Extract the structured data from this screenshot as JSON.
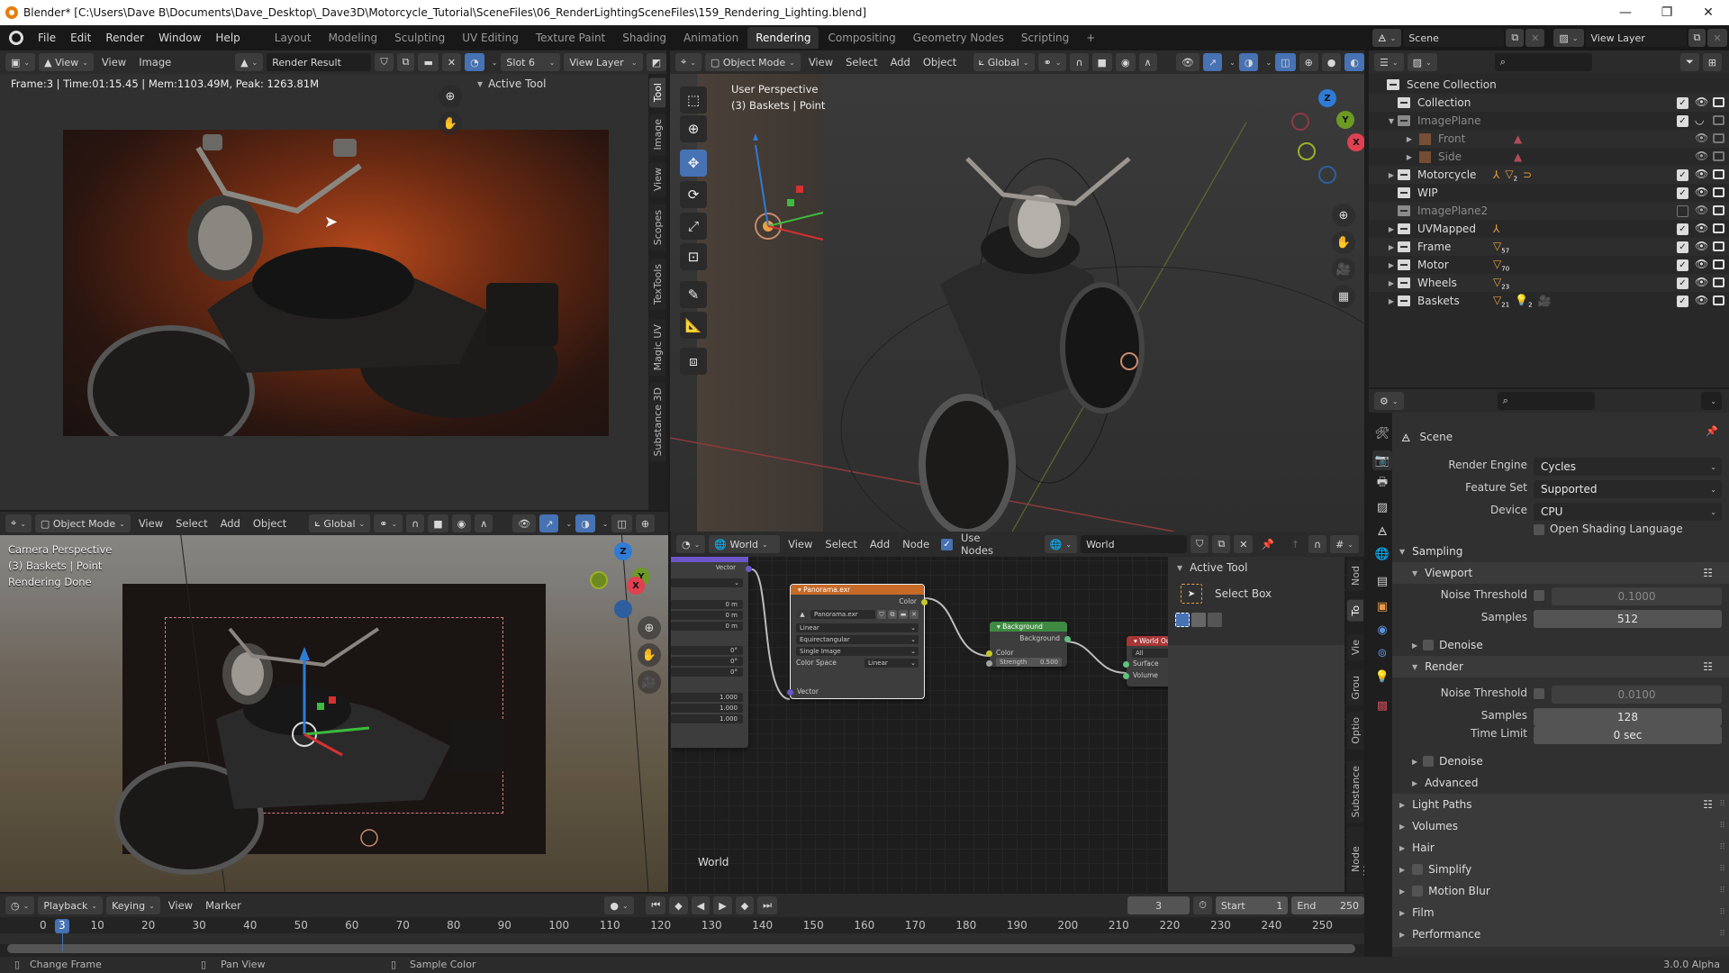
{
  "window": {
    "title": "Blender* [C:\\Users\\Dave B\\Documents\\Dave_Desktop\\_Dave3D\\Motorcycle_Tutorial\\SceneFiles\\06_RenderLightingSceneFiles\\159_Rendering_Lighting.blend]",
    "controls": {
      "minimize": "—",
      "restore": "❐",
      "close": "✕"
    }
  },
  "menubar": {
    "menus": [
      "File",
      "Edit",
      "Render",
      "Window",
      "Help"
    ],
    "workspaces": [
      "Layout",
      "Modeling",
      "Sculpting",
      "UV Editing",
      "Texture Paint",
      "Shading",
      "Animation",
      "Rendering",
      "Compositing",
      "Geometry Nodes",
      "Scripting"
    ],
    "active_workspace": "Rendering",
    "add_tab": "+",
    "scene": "Scene",
    "view_layer": "View Layer"
  },
  "image_editor": {
    "view_mode": "View",
    "menus": [
      "View",
      "Image"
    ],
    "image_name": "Render Result",
    "slot": "Slot 6",
    "layer": "View Layer",
    "render_info": "Frame:3 | Time:01:15.45 | Mem:1103.49M, Peak: 1263.81M",
    "active_tool_panel": "Active Tool",
    "side_tabs": [
      "Tool",
      "Image",
      "View",
      "Scopes",
      "TexTools",
      "Magic UV",
      "Substance 3D"
    ],
    "active_side_tab": "Tool"
  },
  "viewport_top": {
    "mode": "Object Mode",
    "menus": [
      "View",
      "Select",
      "Add",
      "Object"
    ],
    "transform_orientation": "Global",
    "overlay_line1": "User Perspective",
    "overlay_line2": "(3) Baskets | Point",
    "tools": [
      "select-box",
      "cursor",
      "move",
      "rotate",
      "scale",
      "transform",
      "annotate",
      "measure",
      "add-cube"
    ],
    "active_tool": "move",
    "gizmo_axes": {
      "x": "X",
      "y": "Y",
      "z": "Z"
    }
  },
  "viewport_bottom": {
    "mode": "Object Mode",
    "menus": [
      "View",
      "Select",
      "Add",
      "Object"
    ],
    "transform_orientation": "Global",
    "overlay_line1": "Camera Perspective",
    "overlay_line2": "(3) Baskets | Point",
    "overlay_line3": "Rendering Done",
    "gizmo_axes": {
      "x": "X",
      "y": "Y",
      "z": "Z"
    }
  },
  "outliner": {
    "root": "Scene Collection",
    "items": [
      {
        "name": "Collection",
        "indent": 1,
        "expand": false,
        "checked": true,
        "visible": true,
        "render": true,
        "dim": false,
        "badges": []
      },
      {
        "name": "ImagePlane",
        "indent": 1,
        "expand": true,
        "expanded": true,
        "checked": true,
        "visible": false,
        "render": false,
        "dim": true,
        "badges": []
      },
      {
        "name": "Front",
        "indent": 2,
        "expand": true,
        "checked": null,
        "visible": true,
        "render": false,
        "dim": true,
        "badges": [
          "image"
        ]
      },
      {
        "name": "Side",
        "indent": 2,
        "expand": true,
        "checked": null,
        "visible": true,
        "render": false,
        "dim": true,
        "badges": [
          "image"
        ]
      },
      {
        "name": "Motorcycle",
        "indent": 1,
        "expand": true,
        "checked": true,
        "visible": true,
        "render": true,
        "dim": false,
        "badges": [
          "armature",
          "mesh 2",
          "curve"
        ]
      },
      {
        "name": "WIP",
        "indent": 1,
        "expand": false,
        "checked": true,
        "visible": true,
        "render": true,
        "dim": false,
        "badges": []
      },
      {
        "name": "ImagePlane2",
        "indent": 1,
        "expand": false,
        "checked": false,
        "visible": true,
        "render": true,
        "dim": true,
        "badges": []
      },
      {
        "name": "UVMapped",
        "indent": 1,
        "expand": true,
        "checked": true,
        "visible": true,
        "render": true,
        "dim": false,
        "badges": [
          "armature"
        ]
      },
      {
        "name": "Frame",
        "indent": 1,
        "expand": true,
        "checked": true,
        "visible": true,
        "render": true,
        "dim": false,
        "badges": [
          "mesh 57"
        ]
      },
      {
        "name": "Motor",
        "indent": 1,
        "expand": true,
        "checked": true,
        "visible": true,
        "render": true,
        "dim": false,
        "badges": [
          "mesh 70"
        ]
      },
      {
        "name": "Wheels",
        "indent": 1,
        "expand": true,
        "checked": true,
        "visible": true,
        "render": true,
        "dim": false,
        "badges": [
          "mesh 23"
        ]
      },
      {
        "name": "Baskets",
        "indent": 1,
        "expand": true,
        "checked": true,
        "visible": true,
        "render": true,
        "dim": false,
        "badges": [
          "mesh 21",
          "light 2",
          "camera"
        ]
      }
    ]
  },
  "properties": {
    "context": "Scene",
    "render_engine_label": "Render Engine",
    "render_engine": "Cycles",
    "feature_set_label": "Feature Set",
    "feature_set": "Supported",
    "device_label": "Device",
    "device": "CPU",
    "osl_label": "Open Shading Language",
    "osl_checked": false,
    "sampling": {
      "title": "Sampling",
      "viewport": {
        "title": "Viewport",
        "noise_threshold_label": "Noise Threshold",
        "noise_threshold_enabled": false,
        "noise_threshold": "0.1000",
        "samples_label": "Samples",
        "samples": "512",
        "denoise_label": "Denoise"
      },
      "render": {
        "title": "Render",
        "noise_threshold_label": "Noise Threshold",
        "noise_threshold_enabled": false,
        "noise_threshold": "0.0100",
        "samples_label": "Samples",
        "samples": "128",
        "time_limit_label": "Time Limit",
        "time_limit": "0 sec",
        "denoise_label": "Denoise"
      },
      "advanced_label": "Advanced"
    },
    "panels": [
      {
        "label": "Light Paths",
        "checkbox": false
      },
      {
        "label": "Volumes",
        "checkbox": false
      },
      {
        "label": "Hair",
        "checkbox": false
      },
      {
        "label": "Simplify",
        "checkbox": true
      },
      {
        "label": "Motion Blur",
        "checkbox": true
      },
      {
        "label": "Film",
        "checkbox": false
      },
      {
        "label": "Performance",
        "checkbox": false
      }
    ],
    "tabs": [
      "tool",
      "render",
      "output",
      "view-layer",
      "scene",
      "world",
      "collection",
      "object",
      "physics",
      "constraints",
      "data-light",
      "texture"
    ],
    "active_tab": "render"
  },
  "node_editor": {
    "type": "World",
    "menus": [
      "View",
      "Select",
      "Add",
      "Node"
    ],
    "use_nodes_label": "Use Nodes",
    "use_nodes": true,
    "world_name": "World",
    "footer_label": "World",
    "active_tool_title": "Active Tool",
    "active_tool_name": "Select Box",
    "side_tabs": [
      "Nod",
      "To",
      "Vie",
      "Grou",
      "Optio",
      "Substance",
      "Node Wrang"
    ],
    "active_side_tab": "To",
    "mapping_node": {
      "output": "Vector",
      "location": [
        "0 m",
        "0 m",
        "0 m"
      ],
      "rotation": [
        "0°",
        "0°",
        "0°"
      ],
      "scale": [
        "1.000",
        "1.000",
        "1.000"
      ]
    },
    "env_node": {
      "title": "Panorama.exr",
      "output": "Color",
      "image": "Panorama.exr",
      "interpolation": "Linear",
      "projection": "Equirectangular",
      "source": "Single Image",
      "color_space_label": "Color Space",
      "color_space": "Linear",
      "input": "Vector"
    },
    "background_node": {
      "title": "Background",
      "output": "Background",
      "color_input": "Color",
      "strength_label": "Strength",
      "strength": "0.500"
    },
    "output_node": {
      "title": "World Ou",
      "target": "All",
      "surface": "Surface",
      "volume": "Volume"
    }
  },
  "timeline": {
    "menus": [
      "Playback",
      "Keying",
      "View",
      "Marker"
    ],
    "current_frame": "3",
    "start_label": "Start",
    "start": "1",
    "end_label": "End",
    "end": "250",
    "ticks": [
      "0",
      "10",
      "20",
      "30",
      "40",
      "50",
      "60",
      "70",
      "80",
      "90",
      "100",
      "110",
      "120",
      "130",
      "140",
      "150",
      "160",
      "170",
      "180",
      "190",
      "200",
      "210",
      "220",
      "230",
      "240",
      "250"
    ]
  },
  "statusbar": {
    "hints": [
      "Change Frame",
      "Pan View",
      "Sample Color"
    ],
    "version": "3.0.0 Alpha"
  },
  "colors": {
    "accent_blue": "#4772b3",
    "active_orange": "#e87d0d",
    "node_texture": "#c66a27",
    "node_shader": "#3f8a42",
    "node_output": "#a83636",
    "node_vector": "#6a56c8"
  }
}
